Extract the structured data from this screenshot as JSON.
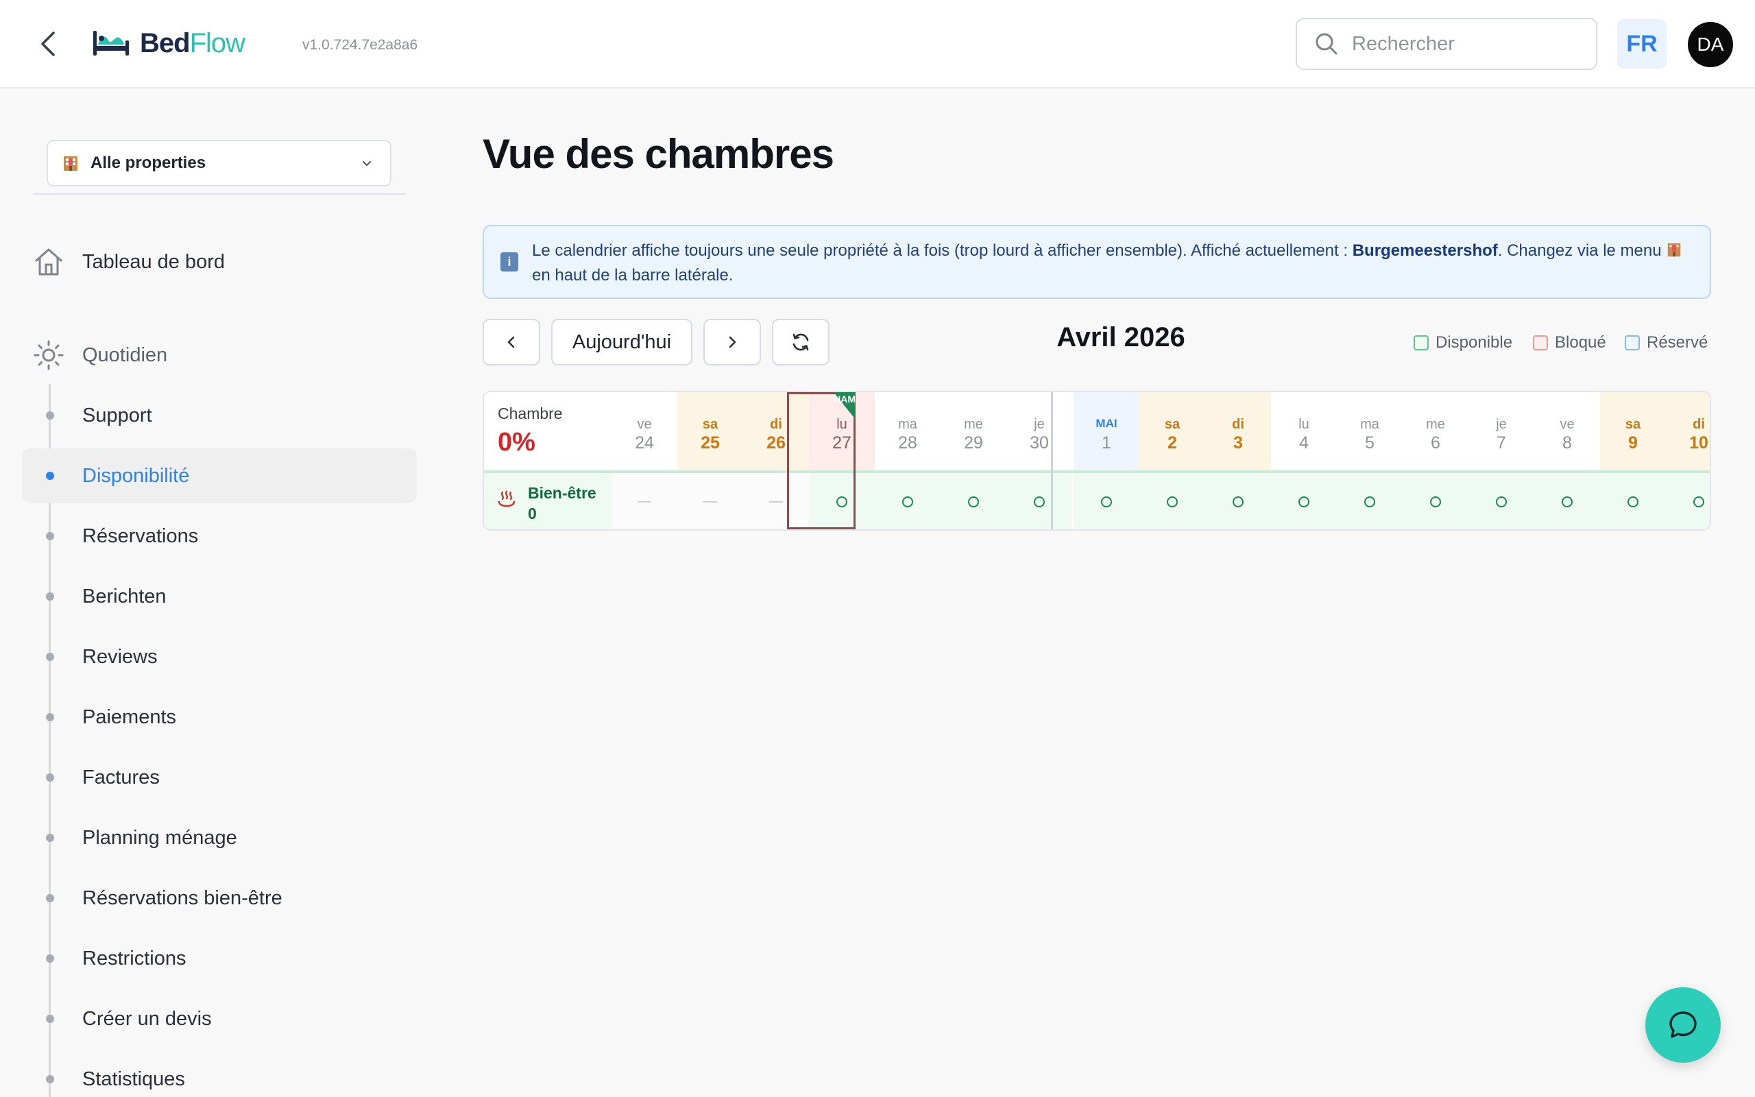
{
  "header": {
    "logo_bed": "Bed",
    "logo_flow": "Flow",
    "version": "v1.0.724.7e2a8a6",
    "search_placeholder": "Rechercher",
    "lang": "FR",
    "avatar": "DA"
  },
  "sidebar": {
    "property_select": "Alle properties",
    "dashboard": "Tableau de bord",
    "daily": "Quotidien",
    "items": [
      {
        "label": "Support"
      },
      {
        "label": "Disponibilité"
      },
      {
        "label": "Réservations"
      },
      {
        "label": "Berichten"
      },
      {
        "label": "Reviews"
      },
      {
        "label": "Paiements"
      },
      {
        "label": "Factures"
      },
      {
        "label": "Planning ménage"
      },
      {
        "label": "Réservations bien-être"
      },
      {
        "label": "Restrictions"
      },
      {
        "label": "Créer un devis"
      },
      {
        "label": "Statistiques"
      }
    ]
  },
  "main": {
    "title": "Vue des chambres",
    "info_before": "Le calendrier affiche toujours une seule propriété à la fois (trop lourd à afficher ensemble). Affiché actuellement : ",
    "info_property": "Burgemeestershof",
    "info_middle": ". Changez via le menu ",
    "info_after": " en haut de la barre latérale.",
    "today_button": "Aujourd'hui",
    "month": "Avril 2026",
    "legend": {
      "available": "Disponible",
      "blocked": "Bloqué",
      "reserved": "Réservé"
    }
  },
  "calendar": {
    "room_header": "Chambre",
    "occupancy": "0%",
    "today_badge": "NAM",
    "rooms": [
      {
        "name": "Bien-être",
        "count": "0"
      }
    ],
    "days": [
      {
        "dow": "ve",
        "num": "24",
        "kind": "past"
      },
      {
        "dow": "sa",
        "num": "25",
        "kind": "past-weekend"
      },
      {
        "dow": "di",
        "num": "26",
        "kind": "past-weekend"
      },
      {
        "dow": "lu",
        "num": "27",
        "kind": "today"
      },
      {
        "dow": "ma",
        "num": "28",
        "kind": "normal"
      },
      {
        "dow": "me",
        "num": "29",
        "kind": "normal"
      },
      {
        "dow": "je",
        "num": "30",
        "kind": "normal"
      },
      {
        "dow": "MAI",
        "num": "1",
        "kind": "month-start"
      },
      {
        "dow": "sa",
        "num": "2",
        "kind": "weekend"
      },
      {
        "dow": "di",
        "num": "3",
        "kind": "weekend"
      },
      {
        "dow": "lu",
        "num": "4",
        "kind": "normal"
      },
      {
        "dow": "ma",
        "num": "5",
        "kind": "normal"
      },
      {
        "dow": "me",
        "num": "6",
        "kind": "normal"
      },
      {
        "dow": "je",
        "num": "7",
        "kind": "normal"
      },
      {
        "dow": "ve",
        "num": "8",
        "kind": "normal"
      },
      {
        "dow": "sa",
        "num": "9",
        "kind": "weekend"
      },
      {
        "dow": "di",
        "num": "10",
        "kind": "weekend"
      }
    ]
  },
  "colors": {
    "accent": "#2e82e6",
    "brand_teal": "#2bc0b0",
    "available": "#178a56",
    "blocked": "#e06b6b",
    "reserved": "#4a8fe0",
    "weekend": "#cc7810",
    "occupancy": "#d02626"
  },
  "icons": [
    "back-chevron-icon",
    "bed-logo-icon",
    "search-icon",
    "building-icon",
    "chevron-down-icon",
    "home-icon",
    "sun-icon",
    "info-icon",
    "chevron-left-icon",
    "chevron-right-icon",
    "refresh-icon",
    "hot-springs-icon",
    "chat-icon"
  ]
}
